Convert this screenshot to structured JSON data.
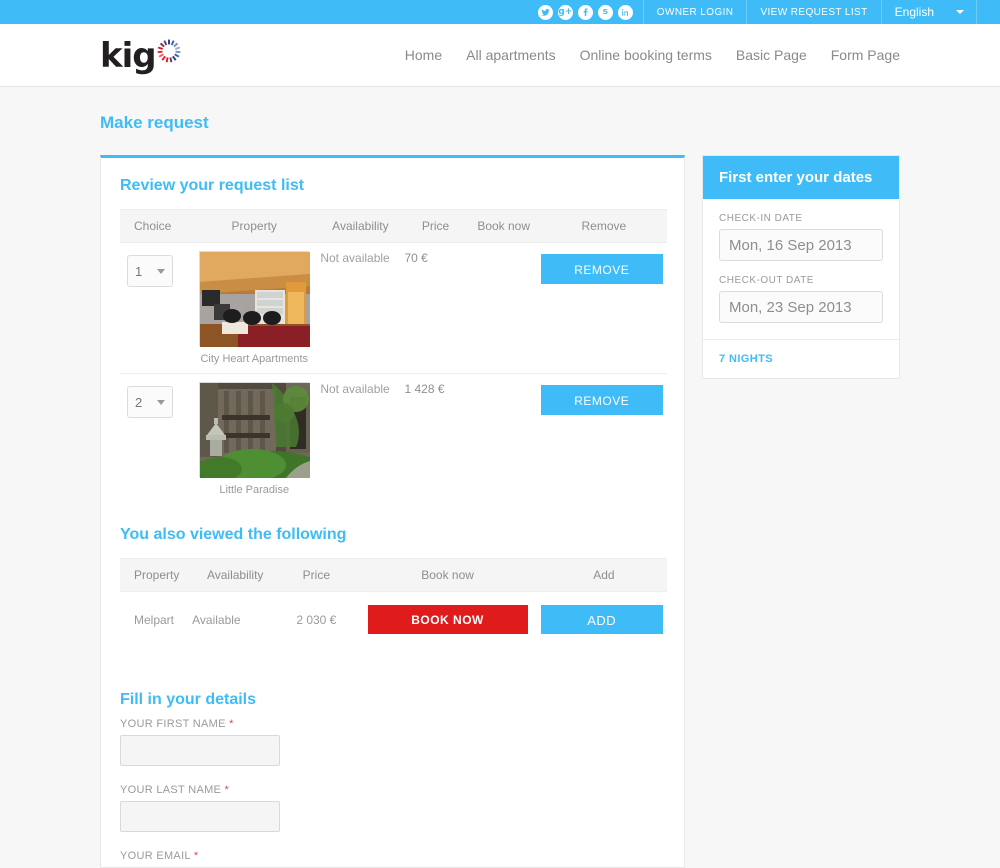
{
  "topbar": {
    "social": [
      {
        "name": "twitter-icon",
        "label": "t"
      },
      {
        "name": "googleplus-icon",
        "label": "g+"
      },
      {
        "name": "facebook-icon",
        "label": "f"
      },
      {
        "name": "skype-icon",
        "label": "s"
      },
      {
        "name": "linkedin-icon",
        "label": "in"
      }
    ],
    "owner_login": "OWNER LOGIN",
    "view_request_list": "VIEW REQUEST LIST",
    "language": "English"
  },
  "header": {
    "logo_text": "kig",
    "nav": [
      {
        "label": "Home"
      },
      {
        "label": "All apartments"
      },
      {
        "label": "Online booking terms"
      },
      {
        "label": "Basic Page"
      },
      {
        "label": "Form Page"
      }
    ]
  },
  "page": {
    "title": "Make request"
  },
  "request_list": {
    "title": "Review your request list",
    "columns": [
      "Choice",
      "Property",
      "Availability",
      "Price",
      "Book now",
      "Remove"
    ],
    "rows": [
      {
        "choice": "1",
        "property": "City Heart Apartments",
        "availability": "Not available",
        "price": "70 €",
        "book_now": "",
        "remove": "REMOVE"
      },
      {
        "choice": "2",
        "property": "Little Paradise",
        "availability": "Not available",
        "price": "1 428 €",
        "book_now": "",
        "remove": "REMOVE"
      }
    ]
  },
  "also_viewed": {
    "title": "You also viewed the following",
    "columns": [
      "Property",
      "Availability",
      "Price",
      "Book now",
      "Add"
    ],
    "rows": [
      {
        "property": "Melpart",
        "availability": "Available",
        "price": "2 030 €",
        "book_now": "BOOK NOW",
        "add": "ADD"
      }
    ]
  },
  "details_form": {
    "title": "Fill in your details",
    "fields": [
      {
        "label": "YOUR FIRST NAME",
        "required": "*",
        "value": ""
      },
      {
        "label": "YOUR LAST NAME",
        "required": "*",
        "value": ""
      },
      {
        "label": "YOUR EMAIL",
        "required": "*",
        "value": ""
      }
    ]
  },
  "dates_panel": {
    "title": "First enter your dates",
    "checkin_label": "CHECK-IN DATE",
    "checkin_value": "Mon, 16 Sep 2013",
    "checkout_label": "CHECK-OUT DATE",
    "checkout_value": "Mon, 23 Sep 2013",
    "nights": "7 NIGHTS"
  },
  "colors": {
    "accent": "#3fbcf7",
    "danger": "#e01b1b",
    "page_bg": "#f7f7f7",
    "text": "#8a8a8a"
  }
}
